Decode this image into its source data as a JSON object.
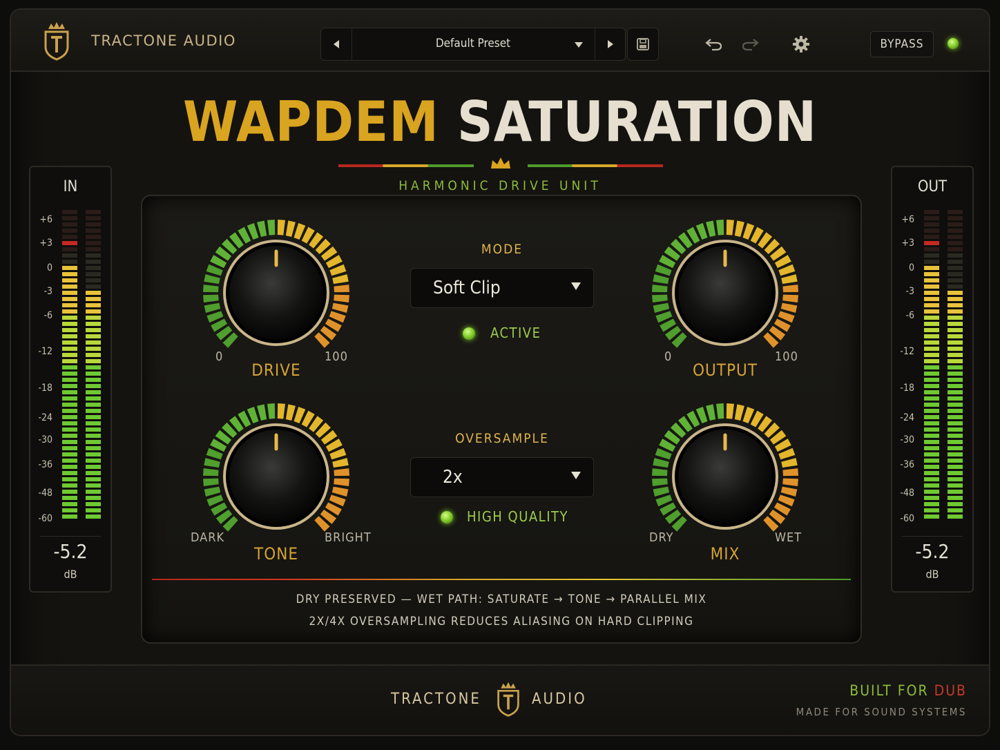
{
  "header": {
    "brand": "TRACTONE AUDIO",
    "preset": "Default Preset",
    "bypass_label": "BYPASS"
  },
  "title": {
    "part1": "WAPDEM",
    "part2": "SATURATION",
    "subtitle": "HARMONIC DRIVE UNIT"
  },
  "meters": {
    "scale": [
      "+6",
      "+3",
      "0",
      "-3",
      "-6",
      "-12",
      "-18",
      "-24",
      "-30",
      "-36",
      "-48",
      "-60"
    ],
    "input": {
      "label": "IN",
      "value": "-5.2",
      "unit": "dB",
      "level_db": -1.5
    },
    "output": {
      "label": "OUT",
      "value": "-5.2",
      "unit": "dB",
      "level_db": -1.5
    }
  },
  "knobs": {
    "drive": {
      "label": "DRIVE",
      "min_label": "0",
      "max_label": "100",
      "value": 0.5
    },
    "output": {
      "label": "OUTPUT",
      "min_label": "0",
      "max_label": "100",
      "value": 0.5
    },
    "tone": {
      "label": "TONE",
      "min_label": "DARK",
      "max_label": "BRIGHT",
      "value": 0.5
    },
    "mix": {
      "label": "MIX",
      "min_label": "DRY",
      "max_label": "WET",
      "value": 0.5
    }
  },
  "mode": {
    "title": "MODE",
    "value": "Soft Clip",
    "active_label": "ACTIVE"
  },
  "oversample": {
    "title": "OVERSAMPLE",
    "value": "2x",
    "hq_label": "HIGH QUALITY"
  },
  "notes": [
    "DRY PRESERVED — WET PATH: SATURATE → TONE → PARALLEL MIX",
    "2X/4X OVERSAMPLING REDUCES ALIASING ON HARD CLIPPING"
  ],
  "footer": {
    "brand_left": "TRACTONE",
    "brand_right": "AUDIO",
    "tag_part1": "BUILT FOR",
    "tag_part2": "DUB",
    "tagline": "MADE FOR SOUND SYSTEMS"
  },
  "colors": {
    "accent_gold": "#d9a420",
    "led_green": "#7fc927",
    "text_green": "#9ccb4c",
    "dub_red": "#c23a26"
  }
}
